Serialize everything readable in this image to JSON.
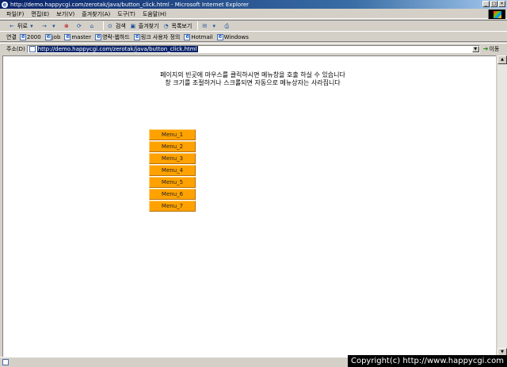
{
  "window": {
    "title": "http://demo.happycgi.com/zerotak/java/button_click.html - Microsoft Internet Explorer",
    "buttons": [
      "_",
      "□",
      "×"
    ]
  },
  "menubar": [
    "파일(F)",
    "편집(E)",
    "보기(V)",
    "즐겨찾기(A)",
    "도구(T)",
    "도움말(H)"
  ],
  "toolbar": {
    "back": "뒤로",
    "forward": "→",
    "search": "검색",
    "favorites": "즐겨찾기",
    "history": "목록보기"
  },
  "links": {
    "label": "연결",
    "items": [
      "2000",
      "job",
      "master",
      "영락-웹하드",
      "링크 사용자 정의",
      "Hotmail",
      "Windows"
    ]
  },
  "address": {
    "label": "주소(D)",
    "url": "http://demo.happycgi.com/zerotak/java/button_click.html",
    "go": "이동"
  },
  "page": {
    "line1": "페이지의 빈곳에 마우스를 클릭하시면 메뉴창을 호출 하실 수 있습니다",
    "line2": "창 크기를 조절하거나 스크롤되면 자동으로 메뉴상자는 사라집니다",
    "menu": [
      "Menu_1",
      "Menu_2",
      "Menu_3",
      "Menu_4",
      "Menu_5",
      "Menu_6",
      "Menu_7"
    ]
  },
  "copyright": "Copyright(c) http://www.happycgi.com",
  "colors": {
    "menu_bg": "#ffa200",
    "title_bg": "#0a246a",
    "selection": "#0a246a"
  }
}
